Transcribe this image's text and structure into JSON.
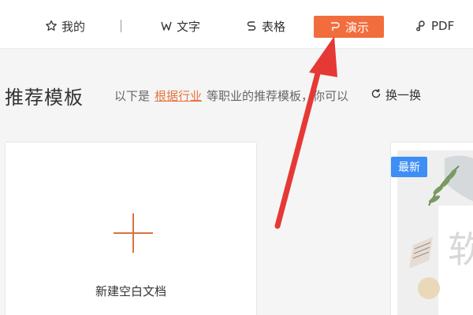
{
  "nav": {
    "mine": "我的",
    "text": "文字",
    "sheet": "表格",
    "present": "演示",
    "pdf": "PDF"
  },
  "section": {
    "title": "推荐模板",
    "sub_prefix": "以下是",
    "sub_link": "根据行业",
    "sub_suffix": "等职业的推荐模板，你可以",
    "refresh": "换一换"
  },
  "cards": {
    "blank_label": "新建空白文档",
    "badge": "最新",
    "template_char": "软"
  },
  "colors": {
    "accent": "#f26d3d",
    "badge": "#3d8ff5",
    "arrow": "#e53935"
  }
}
